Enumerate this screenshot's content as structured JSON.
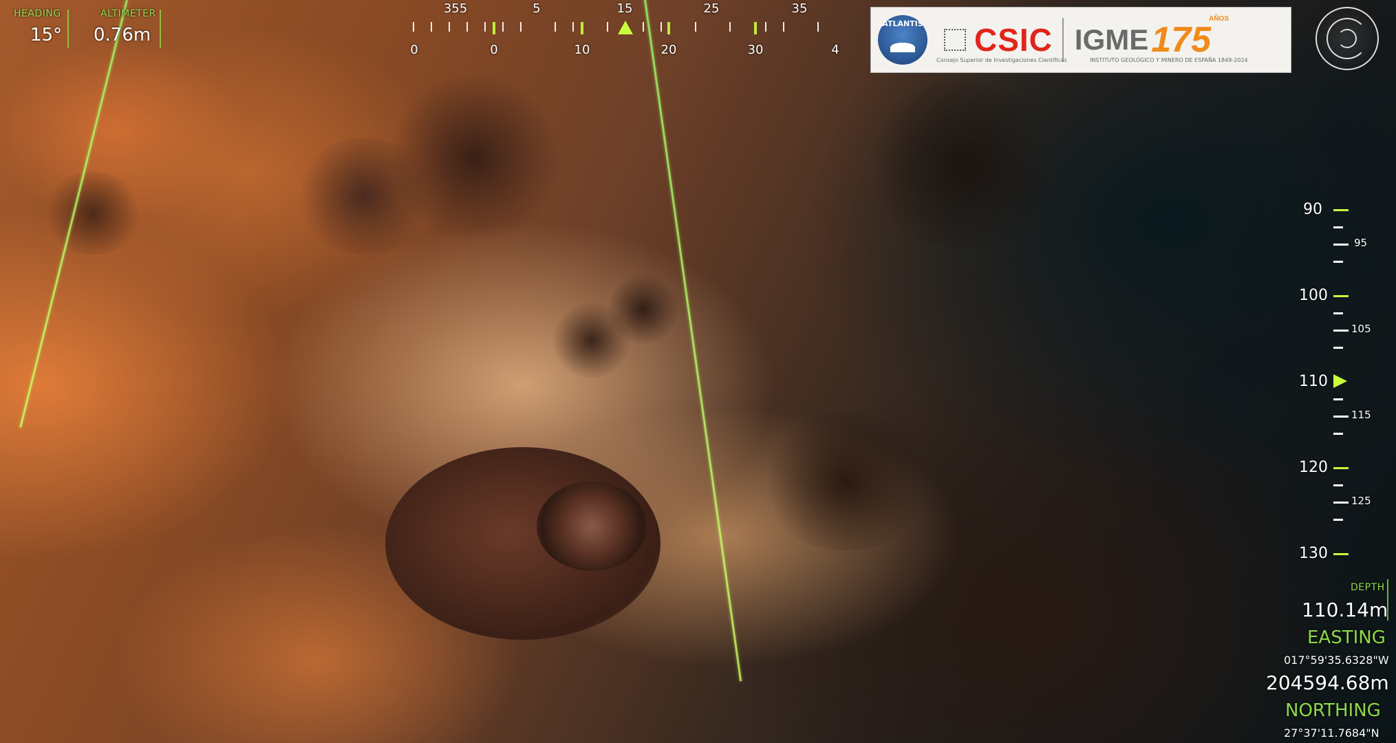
{
  "hud": {
    "heading_label": "HEADING",
    "heading_value": "15°",
    "altimeter_label": "ALTIMETER",
    "altimeter_value": "0.76m",
    "depth_label": "DEPTH",
    "depth_value": "110.14m",
    "easting_label": "EASTING",
    "easting_coord": "017°59'35.6328\"W",
    "easting_value": "204594.68m",
    "northing_label": "NORTHING",
    "northing_coord": "27°37'11.7684\"N"
  },
  "heading_tape": {
    "top_labels": [
      "355",
      "5",
      "15",
      "25",
      "35"
    ],
    "bottom_labels": [
      "0",
      "0",
      "10",
      "20",
      "30",
      "4"
    ]
  },
  "depth_tape": {
    "major_labels": [
      "90",
      "100",
      "110",
      "120",
      "130"
    ],
    "minor_labels": [
      "95",
      "105",
      "115",
      "125"
    ]
  },
  "logos": {
    "atlantis": "ATLANTIS",
    "csic": "CSIC",
    "csic_sub": "Consejo Superior de Investigaciones Científicas",
    "igme": "IGME",
    "igme_anniv": "175",
    "igme_anos": "AÑOS",
    "igme_sub": "INSTITUTO GEOLÓGICO Y MINERO DE ESPAÑA 1849-2024"
  },
  "colors": {
    "hud_green": "#8fd94a",
    "tick_green": "#c8ff3c",
    "csic_red": "#e1251b",
    "igme_orange": "#f08a1a"
  }
}
